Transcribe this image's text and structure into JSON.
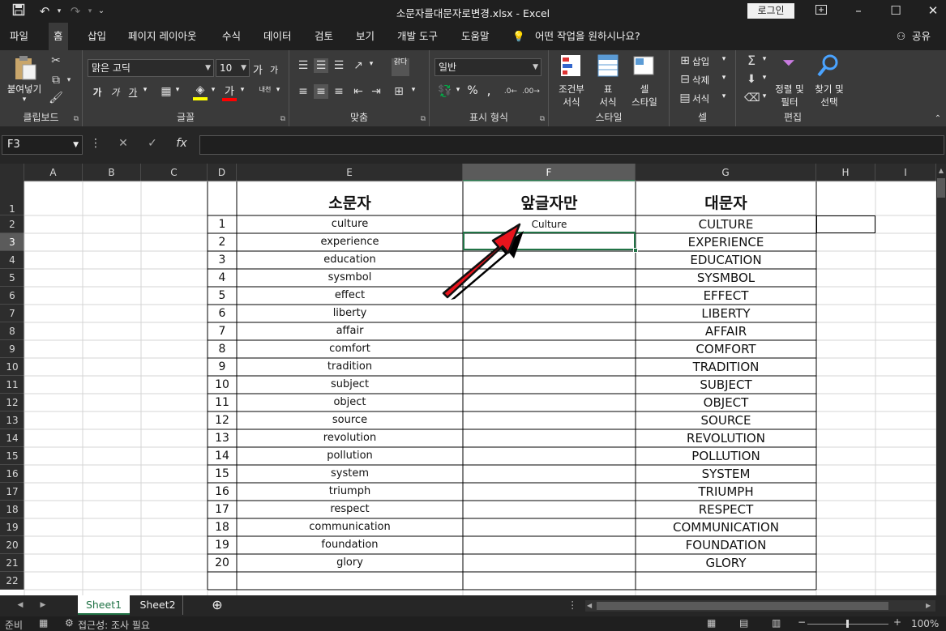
{
  "window": {
    "title": "소문자를대문자로변경.xlsx - Excel",
    "login_label": "로그인",
    "share_label": "공유"
  },
  "ribbon_tabs": [
    "파일",
    "홈",
    "삽입",
    "페이지 레이아웃",
    "수식",
    "데이터",
    "검토",
    "보기",
    "개발 도구",
    "도움말"
  ],
  "tell_me": "어떤 작업을 원하시나요?",
  "ribbon": {
    "clipboard": {
      "paste_label": "붙여넣기",
      "group_label": "클립보드"
    },
    "font": {
      "font_name": "맑은 고딕",
      "font_size": "10",
      "grow_label": "가",
      "shrink_label": "가",
      "bold_label": "가",
      "italic_label": "가",
      "underline_label": "가",
      "phonetic_label": "내천",
      "font_color_label": "가",
      "group_label": "글꼴"
    },
    "alignment": {
      "wrap_label": "갉다",
      "group_label": "맞춤"
    },
    "number": {
      "format": "일반",
      "percent": "%",
      "comma": ",",
      "group_label": "표시 형식"
    },
    "styles": {
      "conditional_label_1": "조건부",
      "conditional_label_2": "서식",
      "table_label_1": "표",
      "table_label_2": "서식",
      "cell_label_1": "셀",
      "cell_label_2": "스타일",
      "group_label": "스타일"
    },
    "cells": {
      "insert_label": "삽입",
      "delete_label": "삭제",
      "format_label": "서식",
      "group_label": "셀"
    },
    "editing": {
      "sort_label_1": "정렬 및",
      "sort_label_2": "필터",
      "find_label_1": "찾기 및",
      "find_label_2": "선택",
      "group_label": "편집"
    }
  },
  "formula_bar": {
    "name_box": "F3",
    "formula": ""
  },
  "columns": [
    "A",
    "B",
    "C",
    "D",
    "E",
    "F",
    "G",
    "H",
    "I"
  ],
  "selected_column": "F",
  "selected_row": 3,
  "headers": {
    "col_e": "소문자",
    "col_f": "앞글자만",
    "col_g": "대문자"
  },
  "rows": [
    {
      "n": "1",
      "lower": "culture",
      "first": "Culture",
      "upper": "CULTURE"
    },
    {
      "n": "2",
      "lower": "experience",
      "first": "",
      "upper": "EXPERIENCE"
    },
    {
      "n": "3",
      "lower": "education",
      "first": "",
      "upper": "EDUCATION"
    },
    {
      "n": "4",
      "lower": "sysmbol",
      "first": "",
      "upper": "SYSMBOL"
    },
    {
      "n": "5",
      "lower": "effect",
      "first": "",
      "upper": "EFFECT"
    },
    {
      "n": "6",
      "lower": "liberty",
      "first": "",
      "upper": "LIBERTY"
    },
    {
      "n": "7",
      "lower": "affair",
      "first": "",
      "upper": "AFFAIR"
    },
    {
      "n": "8",
      "lower": "comfort",
      "first": "",
      "upper": "COMFORT"
    },
    {
      "n": "9",
      "lower": "tradition",
      "first": "",
      "upper": "TRADITION"
    },
    {
      "n": "10",
      "lower": "subject",
      "first": "",
      "upper": "SUBJECT"
    },
    {
      "n": "11",
      "lower": "object",
      "first": "",
      "upper": "OBJECT"
    },
    {
      "n": "12",
      "lower": "source",
      "first": "",
      "upper": "SOURCE"
    },
    {
      "n": "13",
      "lower": "revolution",
      "first": "",
      "upper": "REVOLUTION"
    },
    {
      "n": "14",
      "lower": "pollution",
      "first": "",
      "upper": "POLLUTION"
    },
    {
      "n": "15",
      "lower": "system",
      "first": "",
      "upper": "SYSTEM"
    },
    {
      "n": "16",
      "lower": "triumph",
      "first": "",
      "upper": "TRIUMPH"
    },
    {
      "n": "17",
      "lower": "respect",
      "first": "",
      "upper": "RESPECT"
    },
    {
      "n": "18",
      "lower": "communication",
      "first": "",
      "upper": "COMMUNICATION"
    },
    {
      "n": "19",
      "lower": "foundation",
      "first": "",
      "upper": "FOUNDATION"
    },
    {
      "n": "20",
      "lower": "glory",
      "first": "",
      "upper": "GLORY"
    }
  ],
  "row_numbers": [
    "1",
    "2",
    "3",
    "4",
    "5",
    "6",
    "7",
    "8",
    "9",
    "10",
    "11",
    "12",
    "13",
    "14",
    "15",
    "16",
    "17",
    "18",
    "19",
    "20",
    "21",
    "22"
  ],
  "sheets": [
    "Sheet1",
    "Sheet2"
  ],
  "active_sheet": "Sheet1",
  "status": {
    "mode": "준비",
    "accessibility": "접근성: 조사 필요",
    "zoom": "100%"
  },
  "colors": {
    "accent": "#217346",
    "arrow": "#e8141c",
    "ribbon_bg": "#3a3a3a",
    "title_bg": "#1f1f1f"
  }
}
